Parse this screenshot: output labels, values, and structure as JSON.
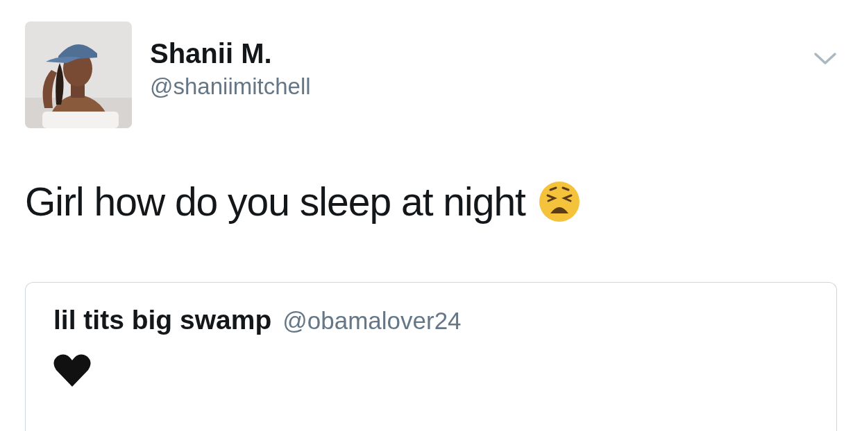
{
  "tweet": {
    "author": {
      "name": "Shanii M.",
      "handle": "@shaniimitchell"
    },
    "text": "Girl how do you sleep at night",
    "quoted": {
      "author": {
        "name": "lil tits big swamp",
        "handle": "@obamalover24"
      }
    }
  }
}
